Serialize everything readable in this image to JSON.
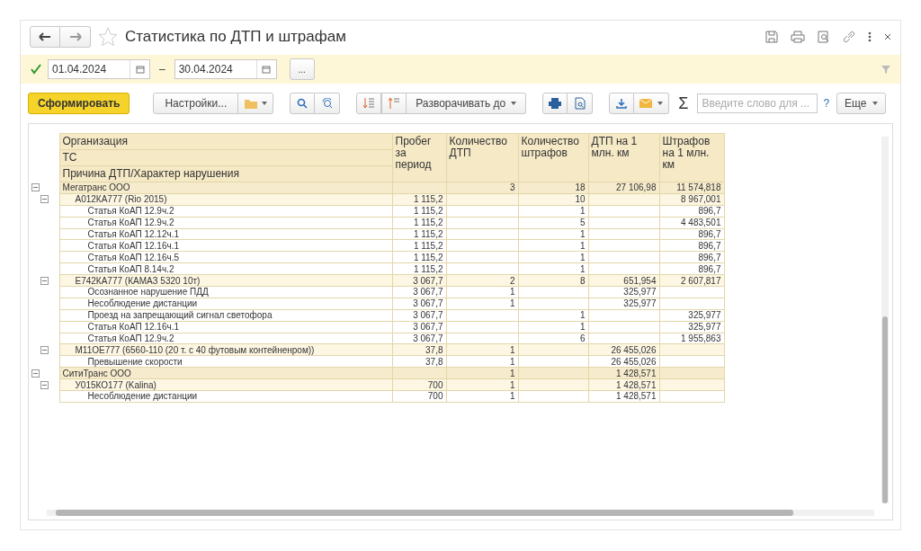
{
  "window": {
    "title": "Статистика по ДТП и штрафам",
    "favorite": false
  },
  "period": {
    "enabled": true,
    "from": "01.04.2024",
    "separator": "–",
    "to": "30.04.2024",
    "more_button": "..."
  },
  "toolbar": {
    "generate": "Сформировать",
    "settings": "Настройки...",
    "expand_to": "Разворачивать до",
    "sum": "Σ",
    "search_placeholder": "Введите слово для ...",
    "help": "?",
    "more": "Еще"
  },
  "report": {
    "group_headers": [
      "Организация",
      "ТС",
      "Причина ДТП/Характер нарушения"
    ],
    "columns": [
      "Пробег за период",
      "Количество ДТП",
      "Количество штрафов",
      "ДТП на 1 млн. км",
      "Штрафов на 1 млн. км"
    ],
    "rows": [
      {
        "label": "Мегатранс ООО",
        "values": {
          "accidents": "3",
          "fines": "18",
          "accidents_per_mkm": "27 106,98",
          "fines_per_mkm": "11 574,818"
        },
        "expanded": true,
        "children": [
          {
            "label": "А012КА777 (Rio 2015)",
            "values": {
              "mileage": "1 115,2",
              "fines": "10",
              "fines_per_mkm": "8 967,001"
            },
            "expanded": true,
            "children": [
              {
                "label": "Статья КоАП 12.9ч.2",
                "values": {
                  "mileage": "1 115,2",
                  "fines": "1",
                  "fines_per_mkm": "896,7"
                }
              },
              {
                "label": "Статья КоАП 12.9ч.2",
                "values": {
                  "mileage": "1 115,2",
                  "fines": "5",
                  "fines_per_mkm": "4 483,501"
                }
              },
              {
                "label": "Статья КоАП 12.12ч.1",
                "values": {
                  "mileage": "1 115,2",
                  "fines": "1",
                  "fines_per_mkm": "896,7"
                }
              },
              {
                "label": "Статья КоАП 12.16ч.1",
                "values": {
                  "mileage": "1 115,2",
                  "fines": "1",
                  "fines_per_mkm": "896,7"
                }
              },
              {
                "label": "Статья КоАП 12.16ч.5",
                "values": {
                  "mileage": "1 115,2",
                  "fines": "1",
                  "fines_per_mkm": "896,7"
                }
              },
              {
                "label": "Статья КоАП 8.14ч.2",
                "values": {
                  "mileage": "1 115,2",
                  "fines": "1",
                  "fines_per_mkm": "896,7"
                }
              }
            ]
          },
          {
            "label": "Е742КА777 (КАМАЗ 5320 10т)",
            "values": {
              "mileage": "3 067,7",
              "accidents": "2",
              "fines": "8",
              "accidents_per_mkm": "651,954",
              "fines_per_mkm": "2 607,817"
            },
            "expanded": true,
            "children": [
              {
                "label": "Осознанное нарушение ПДД",
                "values": {
                  "mileage": "3 067,7",
                  "accidents": "1",
                  "accidents_per_mkm": "325,977"
                }
              },
              {
                "label": "Несоблюдение дистанции",
                "values": {
                  "mileage": "3 067,7",
                  "accidents": "1",
                  "accidents_per_mkm": "325,977"
                }
              },
              {
                "label": "Проезд на запрещающий сигнал светофора",
                "values": {
                  "mileage": "3 067,7",
                  "fines": "1",
                  "fines_per_mkm": "325,977"
                }
              },
              {
                "label": "Статья КоАП 12.16ч.1",
                "values": {
                  "mileage": "3 067,7",
                  "fines": "1",
                  "fines_per_mkm": "325,977"
                }
              },
              {
                "label": "Статья КоАП 12.9ч.2",
                "values": {
                  "mileage": "3 067,7",
                  "fines": "6",
                  "fines_per_mkm": "1 955,863"
                }
              }
            ]
          },
          {
            "label": "М11ОЕ777 (6560-110 (20 т. с 40 футовым контейненром))",
            "values": {
              "mileage": "37,8",
              "accidents": "1",
              "accidents_per_mkm": "26 455,026"
            },
            "expanded": true,
            "children": [
              {
                "label": "Превышение скорости",
                "values": {
                  "mileage": "37,8",
                  "accidents": "1",
                  "accidents_per_mkm": "26 455,026"
                }
              }
            ]
          }
        ]
      },
      {
        "label": "СитиТранс ООО",
        "values": {
          "accidents": "1",
          "accidents_per_mkm": "1 428,571"
        },
        "expanded": true,
        "children": [
          {
            "label": "У015КО177 (Kalina)",
            "values": {
              "mileage": "700",
              "accidents": "1",
              "accidents_per_mkm": "1 428,571"
            },
            "expanded": true,
            "children": [
              {
                "label": "Несоблюдение дистанции",
                "values": {
                  "mileage": "700",
                  "accidents": "1",
                  "accidents_per_mkm": "1 428,571"
                }
              }
            ]
          }
        ]
      }
    ]
  }
}
